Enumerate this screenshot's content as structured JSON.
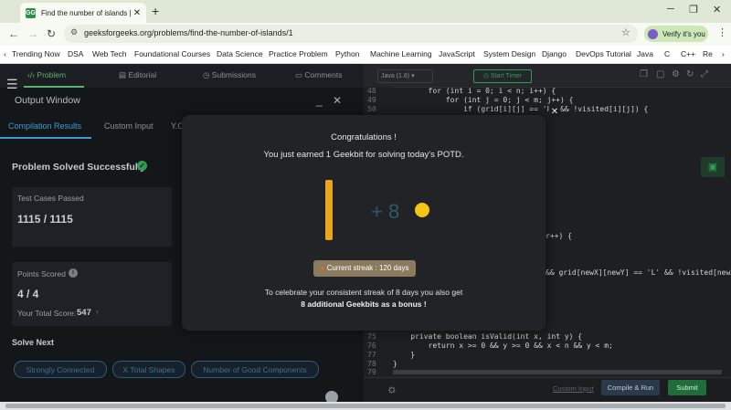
{
  "browser": {
    "tab_title": "Find the number of islands | Pr",
    "favicon_text": "GG",
    "url": "geeksforgeeks.org/problems/find-the-number-of-islands/1",
    "verify_label": "Verify it's you"
  },
  "site_nav": {
    "items": [
      "Trending Now",
      "DSA",
      "Web Tech",
      "Foundational Courses",
      "Data Science",
      "Practice Problem",
      "Python",
      "Machine Learning",
      "JavaScript",
      "System Design",
      "Django",
      "DevOps Tutorial",
      "Java",
      "C",
      "C++",
      "Re"
    ]
  },
  "problem_tabs": [
    "Problem",
    "Editorial",
    "Submissions",
    "Comments"
  ],
  "output_window": {
    "title": "Output Window",
    "subtabs": [
      "Compilation Results",
      "Custom Input",
      "Y.O"
    ],
    "status": "Problem Solved Successfully",
    "test_cases_label": "Test Cases Passed",
    "test_cases_value": "1115 / 1115",
    "points_label": "Points Scored",
    "points_value": "4 / 4",
    "total_score_label": "Your Total Score:",
    "total_score_value": "547",
    "solve_next_label": "Solve Next",
    "solve_next_chips": [
      "Strongly Connected",
      "X Total Shapes",
      "Number of Good Components"
    ]
  },
  "editor": {
    "language": "Java (1.8)",
    "timer_label": "Start Timer",
    "lines_top": [
      {
        "n": "48",
        "code": "        for (int i = 0; i < n; i++) {"
      },
      {
        "n": "49",
        "code": "            for (int j = 0; j < m; j++) {"
      },
      {
        "n": "50",
        "code": "                if (grid[i][j] == 'L' && !visited[i][j]) {"
      }
    ],
    "frag1": "r++) {",
    "frag2": "&& grid[newX][newY] == 'L' && !visited[newX]",
    "lines_bottom": [
      {
        "n": "75",
        "code": "    private boolean isValid(int x, int y) {"
      },
      {
        "n": "76",
        "code": "        return x >= 0 && y >= 0 && x < n && y < m;"
      },
      {
        "n": "77",
        "code": "    }"
      },
      {
        "n": "78",
        "code": "}"
      },
      {
        "n": "79",
        "code": ""
      }
    ],
    "custom_input_label": "Custom Input",
    "compile_run_label": "Compile & Run",
    "submit_label": "Submit"
  },
  "modal": {
    "title": "Congratulations !",
    "message": "You just earned 1 Geekbit for solving today's POTD.",
    "bonus_amount": "+ 8",
    "streak_label": "Current streak : 120 days",
    "celebrate_line1": "To celebrate your consistent streak of 8 days you also get",
    "celebrate_line2": "8 additional Geekbits as a bonus !"
  },
  "colors": {
    "accent_green": "#2f9e55",
    "link_blue": "#3e9bd6",
    "coin_yellow": "#f3c514"
  }
}
